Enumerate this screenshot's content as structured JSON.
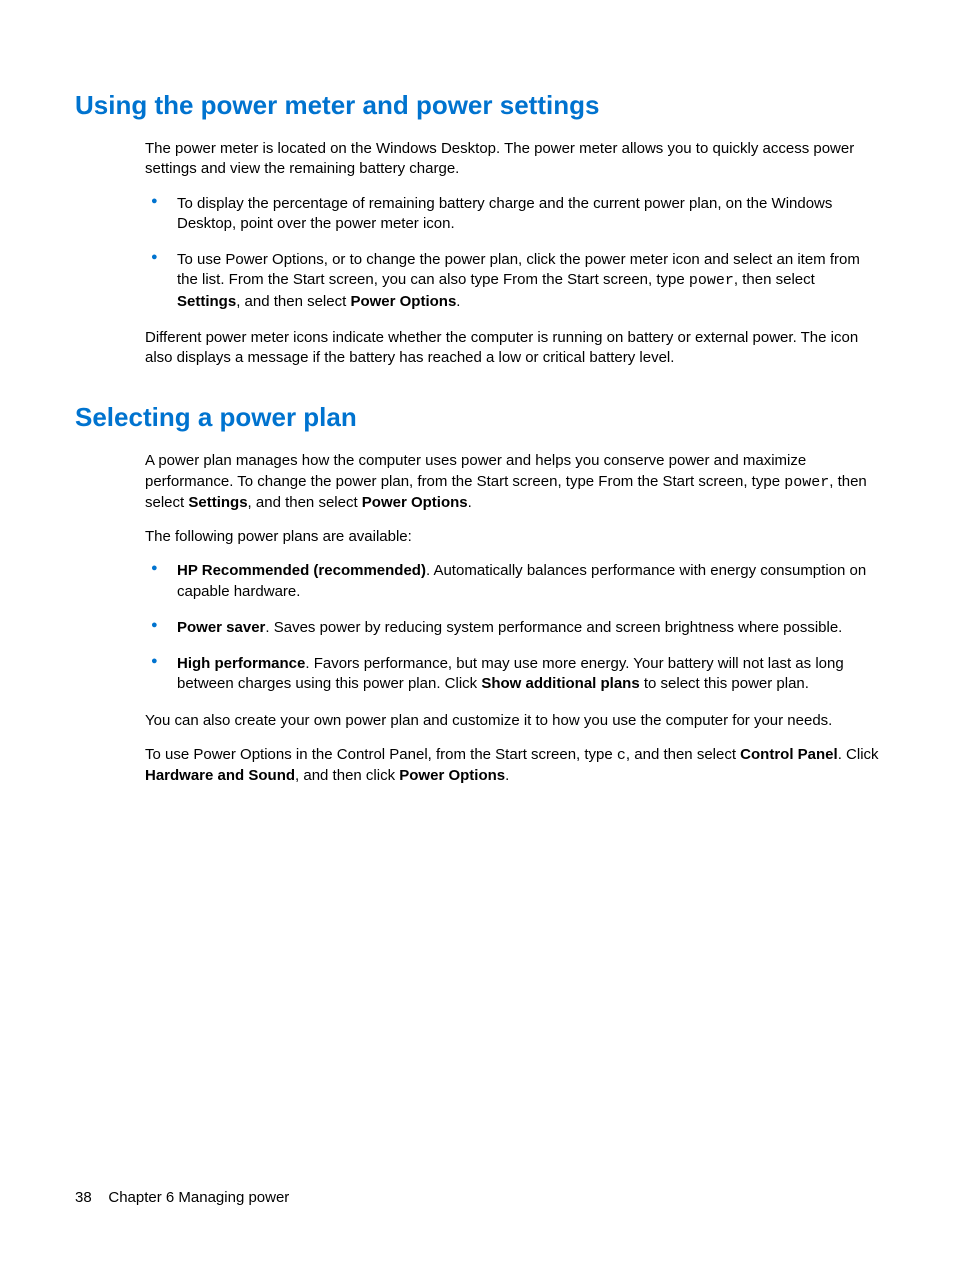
{
  "section1": {
    "heading": "Using the power meter and power settings",
    "intro": "The power meter is located on the Windows Desktop. The power meter allows you to quickly access power settings and view the remaining battery charge.",
    "bullet1": "To display the percentage of remaining battery charge and the current power plan, on the Windows Desktop, point over the power meter icon.",
    "bullet2_a": "To use Power Options, or to change the power plan, click the power meter icon and select an item from the list. From the Start screen, you can also type From the Start screen, type ",
    "bullet2_code": "power",
    "bullet2_b": ", then select ",
    "bullet2_bold1": "Settings",
    "bullet2_c": ", and then select ",
    "bullet2_bold2": "Power Options",
    "bullet2_d": ".",
    "outro": "Different power meter icons indicate whether the computer is running on battery or external power. The icon also displays a message if the battery has reached a low or critical battery level."
  },
  "section2": {
    "heading": "Selecting a power plan",
    "p1_a": "A power plan manages how the computer uses power and helps you conserve power and maximize performance. To change the power plan, from the Start screen, type From the Start screen, type ",
    "p1_code": "power",
    "p1_b": ", then select ",
    "p1_bold1": "Settings",
    "p1_c": ", and then select ",
    "p1_bold2": "Power Options",
    "p1_d": ".",
    "p2": "The following power plans are available:",
    "bullet1_bold": "HP Recommended (recommended)",
    "bullet1_rest": ". Automatically balances performance with energy consumption on capable hardware.",
    "bullet2_bold": "Power saver",
    "bullet2_rest": ". Saves power by reducing system performance and screen brightness where possible.",
    "bullet3_bold": "High performance",
    "bullet3_a": ". Favors performance, but may use more energy. Your battery will not last as long between charges using this power plan. Click ",
    "bullet3_bold2": "Show additional plans",
    "bullet3_b": " to select this power plan.",
    "p3": "You can also create your own power plan and customize it to how you use the computer for your needs.",
    "p4_a": "To use Power Options in the Control Panel, from the Start screen, type ",
    "p4_code": "c",
    "p4_b": ", and then select ",
    "p4_bold1": "Control Panel",
    "p4_c": ". Click ",
    "p4_bold2": "Hardware and Sound",
    "p4_d": ", and then click ",
    "p4_bold3": "Power Options",
    "p4_e": "."
  },
  "footer": {
    "page_number": "38",
    "chapter": "Chapter 6   Managing power"
  }
}
